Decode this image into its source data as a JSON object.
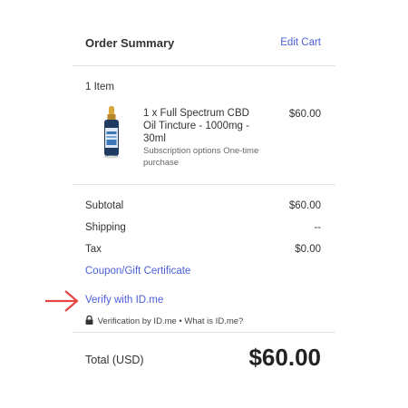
{
  "header": {
    "title": "Order Summary",
    "edit_cart": "Edit Cart"
  },
  "cart": {
    "item_count": "1 Item",
    "items": [
      {
        "name": "1 x Full Spectrum CBD Oil Tincture - 1000mg - 30ml",
        "options": "Subscription options One-time purchase",
        "price": "$60.00"
      }
    ]
  },
  "totals": {
    "subtotal_label": "Subtotal",
    "subtotal_value": "$60.00",
    "shipping_label": "Shipping",
    "shipping_value": "--",
    "tax_label": "Tax",
    "tax_value": "$0.00",
    "coupon_link": "Coupon/Gift Certificate",
    "verify_link": "Verify with ID.me",
    "verification_text": "Verification by ID.me",
    "separator": "•",
    "what_is_link": "What is ID.me?",
    "total_label": "Total (USD)",
    "total_value": "$60.00"
  },
  "icons": {
    "arrow": "arrow-right-icon",
    "lock": "lock-icon",
    "product": "tincture-bottle-icon"
  },
  "colors": {
    "link": "#4a5fd8",
    "arrow": "#e84545"
  }
}
